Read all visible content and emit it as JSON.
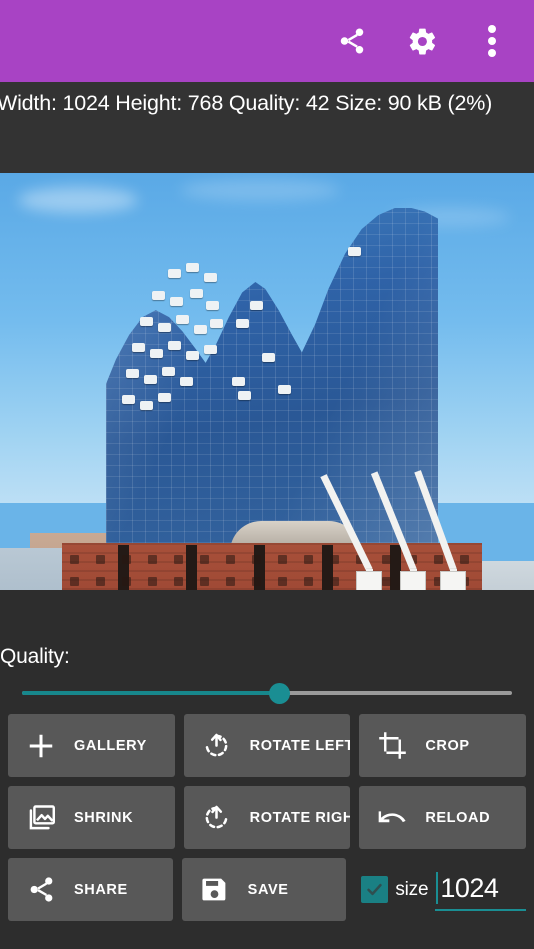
{
  "appbar": {
    "background_color": "#a843c4",
    "actions": [
      {
        "name": "share-icon",
        "label": "Share"
      },
      {
        "name": "settings-icon",
        "label": "Settings"
      },
      {
        "name": "overflow-menu-icon",
        "label": "More options"
      }
    ]
  },
  "info": {
    "text": "Width: 1024 Height: 768 Quality: 42 Size: 90 kB (2%)",
    "width": "1024",
    "height": "768",
    "quality": "42",
    "size": "90 kB",
    "size_percent": "2%"
  },
  "preview": {
    "alt": "Elbphilharmonie concert hall, Hamburg harbour, glass wave roof over red brick warehouse with white harbour cranes"
  },
  "quality_slider": {
    "label": "Quality:",
    "value": 42,
    "min": 0,
    "max": 100,
    "percent": 52.4,
    "active_color": "#17878c",
    "track_color": "#9a9a9a"
  },
  "buttons": {
    "rows": [
      [
        {
          "label": "GALLERY",
          "icon": "plus-icon"
        },
        {
          "label": "ROTATE LEFT",
          "icon": "rotate-left-icon"
        },
        {
          "label": "CROP",
          "icon": "crop-icon"
        }
      ],
      [
        {
          "label": "SHRINK",
          "icon": "image-stack-icon"
        },
        {
          "label": "ROTATE RIGHT",
          "icon": "rotate-right-icon"
        },
        {
          "label": "RELOAD",
          "icon": "undo-arrow-icon"
        }
      ],
      [
        {
          "label": "SHARE",
          "icon": "share-icon"
        },
        {
          "label": "SAVE",
          "icon": "floppy-disk-icon"
        }
      ]
    ],
    "background_color": "#585858"
  },
  "size_control": {
    "checkbox_checked": true,
    "checkbox_color": "#1a8084",
    "label": "size",
    "value": "1024",
    "placeholder": "size",
    "accent_color": "#1a8e93"
  }
}
